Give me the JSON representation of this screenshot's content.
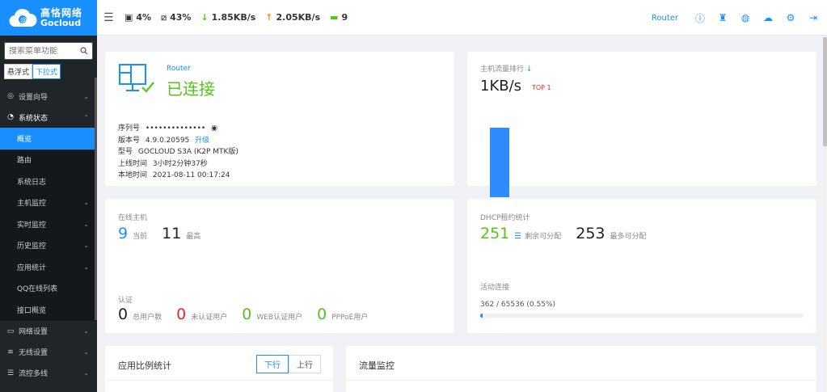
{
  "brand": {
    "cn": "高恪网络",
    "en": "Gocloud"
  },
  "sidebar": {
    "search_placeholder": "搜索菜单功能",
    "modes": [
      "悬浮式",
      "下拉式"
    ],
    "items": [
      {
        "label": "设置向导",
        "icon": "compass-icon"
      },
      {
        "label": "系统状态",
        "icon": "dashboard-icon"
      },
      {
        "label": "网络设置",
        "icon": "monitor-icon"
      },
      {
        "label": "无线设置",
        "icon": "wifi-icon"
      },
      {
        "label": "流控多线",
        "icon": "flow-icon"
      }
    ],
    "sub_items": [
      "概览",
      "路由",
      "系统日志",
      "主机监控",
      "实时监控",
      "历史监控",
      "应用统计",
      "QQ在线列表",
      "接口概览"
    ]
  },
  "topbar": {
    "cpu": "4%",
    "mem": "43%",
    "down": "1.85KB/s",
    "up": "2.05KB/s",
    "hosts": "9",
    "router_label": "Router"
  },
  "device": {
    "model_link": "Router",
    "status": "已连接",
    "serial_label": "序列号",
    "serial_value": "••••••••••••••",
    "version_label": "版本号",
    "version_value": "4.9.0.20595",
    "upgrade": "升级",
    "type_label": "型号",
    "type_value": "GOCLOUD S3A (K2P MTK版)",
    "uptime_label": "上线时间",
    "uptime_value": "3小时2分钟37秒",
    "localtime_label": "本地时间",
    "localtime_value": "2021-08-11 00:17:24"
  },
  "traffic_rank": {
    "title": "主机流量排行",
    "rate": "1KB/s",
    "top": "TOP 1"
  },
  "online": {
    "title": "在线主机",
    "current": "9",
    "current_label": "当前",
    "max": "11",
    "max_label": "最高",
    "auth_title": "认证",
    "total": "0",
    "total_label": "总用户数",
    "unauth": "0",
    "unauth_label": "未认证用户",
    "web": "0",
    "web_label": "WEB认证用户",
    "pppoe": "0",
    "pppoe_label": "PPPoE用户"
  },
  "dhcp": {
    "title": "DHCP租约统计",
    "remain": "251",
    "remain_label": "剩余可分配",
    "max": "253",
    "max_label": "最多可分配",
    "conn_title": "活动连接",
    "conn_text": "362 / 65536 (0.55%)",
    "conn_fraction": 0.0055
  },
  "app_ratio": {
    "title": "应用比例统计",
    "tabs": [
      "下行",
      "上行"
    ]
  },
  "flow_monitor": {
    "title": "流量监控"
  },
  "colors": {
    "accent": "#1890ff",
    "green": "#52c41a",
    "red": "#f5222d",
    "sidebar": "#1f2529"
  }
}
